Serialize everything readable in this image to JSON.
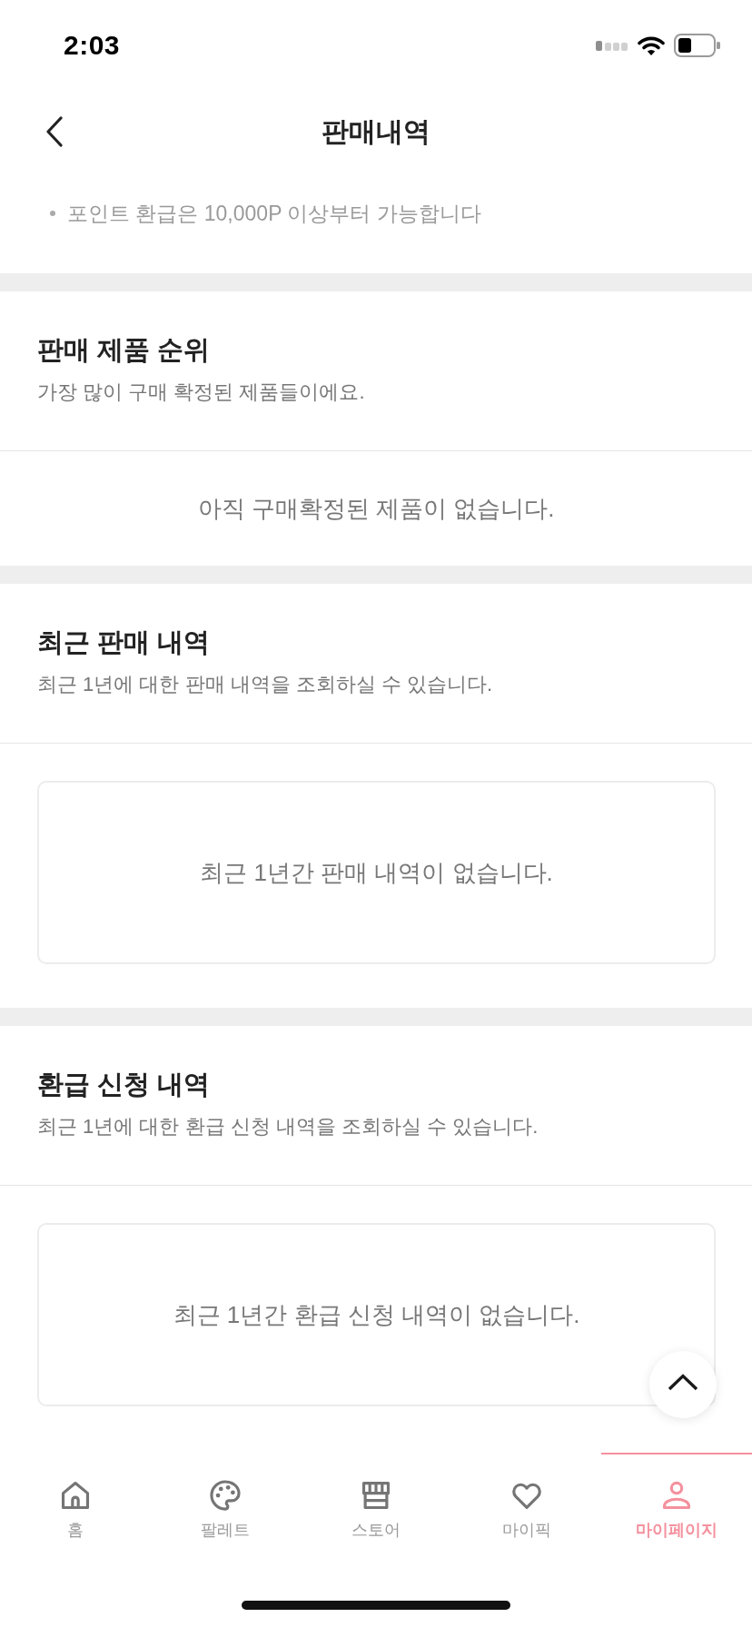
{
  "status_bar": {
    "time": "2:03"
  },
  "header": {
    "title": "판매내역"
  },
  "notice": {
    "items": [
      "포인트 환급은 10,000P 이상부터 가능합니다"
    ]
  },
  "sections": [
    {
      "kind": "plain",
      "title": "판매 제품 순위",
      "subtitle": "가장 많이 구매 확정된 제품들이에요.",
      "empty_message": "아직 구매확정된 제품이 없습니다."
    },
    {
      "kind": "boxed",
      "title": "최근 판매 내역",
      "subtitle": "최근 1년에 대한 판매 내역을 조회하실 수 있습니다.",
      "empty_message": "최근 1년간 판매 내역이 없습니다."
    },
    {
      "kind": "boxed",
      "title": "환급 신청 내역",
      "subtitle": "최근 1년에 대한 환급 신청 내역을 조회하실 수 있습니다.",
      "empty_message": "최근 1년간 환급 신청 내역이 없습니다."
    }
  ],
  "tab_bar": {
    "tabs": [
      {
        "label": "홈",
        "selected": false
      },
      {
        "label": "팔레트",
        "selected": false
      },
      {
        "label": "스토어",
        "selected": false
      },
      {
        "label": "마이픽",
        "selected": false
      },
      {
        "label": "마이페이지",
        "selected": true
      }
    ]
  }
}
